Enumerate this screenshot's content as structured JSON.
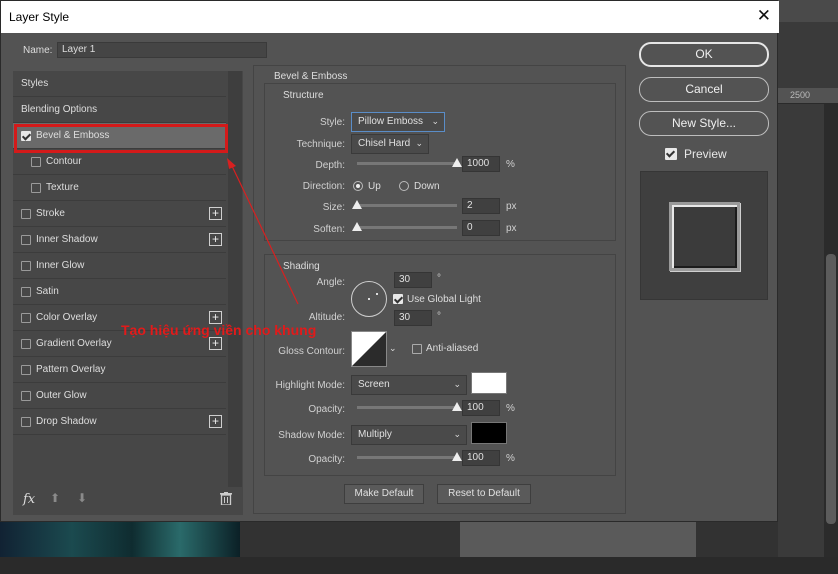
{
  "dialog": {
    "title": "Layer Style",
    "close_glyph": "✕",
    "name_label": "Name:",
    "name_value": "Layer 1"
  },
  "styles_list": [
    {
      "label": "Styles"
    },
    {
      "label": "Blending Options"
    },
    {
      "label": "Bevel & Emboss",
      "checked": true,
      "selected": true
    },
    {
      "label": "Contour",
      "checked": false,
      "sub": true
    },
    {
      "label": "Texture",
      "checked": false,
      "sub": true
    },
    {
      "label": "Stroke",
      "checked": false,
      "plus": true
    },
    {
      "label": "Inner Shadow",
      "checked": false,
      "plus": true
    },
    {
      "label": "Inner Glow",
      "checked": false
    },
    {
      "label": "Satin",
      "checked": false
    },
    {
      "label": "Color Overlay",
      "checked": false,
      "plus": true
    },
    {
      "label": "Gradient Overlay",
      "checked": false,
      "plus": true
    },
    {
      "label": "Pattern Overlay",
      "checked": false
    },
    {
      "label": "Outer Glow",
      "checked": false
    },
    {
      "label": "Drop Shadow",
      "checked": false,
      "plus": true
    }
  ],
  "styles_footer": {
    "fx": "fx",
    "up": "⬆",
    "down": "⬇"
  },
  "bevel": {
    "section_title": "Bevel & Emboss",
    "structure": {
      "title": "Structure",
      "style_label": "Style:",
      "style_value": "Pillow Emboss",
      "technique_label": "Technique:",
      "technique_value": "Chisel Hard",
      "depth_label": "Depth:",
      "depth_value": "1000",
      "depth_unit": "%",
      "depth_level": 1.0,
      "direction_label": "Direction:",
      "dir_up": "Up",
      "dir_down": "Down",
      "size_label": "Size:",
      "size_value": "2",
      "size_unit": "px",
      "size_level": 0.0,
      "soften_label": "Soften:",
      "soften_value": "0",
      "soften_unit": "px",
      "soften_level": 0.0
    },
    "shading": {
      "title": "Shading",
      "angle_label": "Angle:",
      "angle_value": "30",
      "angle_unit": "°",
      "use_global_light": "Use Global Light",
      "altitude_label": "Altitude:",
      "altitude_value": "30",
      "altitude_unit": "°",
      "gloss_label": "Gloss Contour:",
      "anti_aliased": "Anti-aliased",
      "highlight_label": "Highlight Mode:",
      "highlight_value": "Screen",
      "highlight_color": "#ffffff",
      "h_opacity_label": "Opacity:",
      "h_opacity_value": "100",
      "h_opacity_unit": "%",
      "h_opacity_level": 1.0,
      "shadow_label": "Shadow Mode:",
      "shadow_value": "Multiply",
      "shadow_color": "#000000",
      "s_opacity_label": "Opacity:",
      "s_opacity_value": "100",
      "s_opacity_unit": "%",
      "s_opacity_level": 1.0
    },
    "make_default": "Make Default",
    "reset_default": "Reset to Default"
  },
  "actions": {
    "ok": "OK",
    "cancel": "Cancel",
    "new_style": "New Style...",
    "preview": "Preview"
  },
  "annotation": {
    "text": "Tạo hiệu ứng viền cho khung",
    "color": "#e21a1a"
  },
  "background": {
    "ruler_value": "2500"
  }
}
